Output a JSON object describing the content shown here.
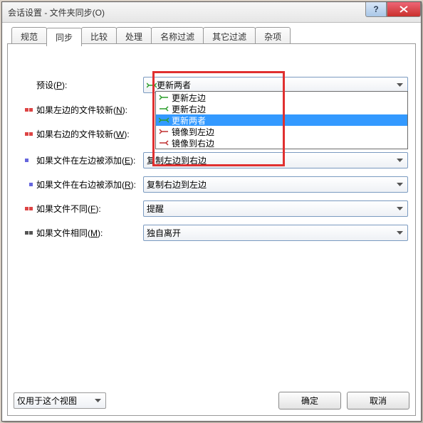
{
  "window": {
    "title": "会话设置 - 文件夹同步(O)"
  },
  "tabs": [
    "规范",
    "同步",
    "比较",
    "处理",
    "名称过滤",
    "其它过滤",
    "杂项"
  ],
  "active_tab": 1,
  "preset": {
    "label_prefix": "预设(",
    "label_key": "P",
    "label_suffix": "):",
    "value": "更新两者",
    "options": [
      "更新左边",
      "更新右边",
      "更新两者",
      "镜像到左边",
      "镜像到右边"
    ],
    "selected_index": 2
  },
  "rows": [
    {
      "bullet": [
        "#d44",
        "#d44"
      ],
      "label_prefix": "如果左边的文件较新(",
      "label_key": "N",
      "label_suffix": "):"
    },
    {
      "bullet": [
        "#d44",
        "#d44"
      ],
      "label_prefix": "如果右边的文件较新(",
      "label_key": "W",
      "label_suffix": "):"
    },
    {
      "bullet": [
        "#66d",
        ""
      ],
      "label_prefix": "如果文件在左边被添加(",
      "label_key": "E",
      "label_suffix": "):",
      "combo": "复制左边到右边"
    },
    {
      "bullet": [
        "",
        "#66d"
      ],
      "label_prefix": "如果文件在右边被添加(",
      "label_key": "R",
      "label_suffix": "):",
      "combo": "复制右边到左边"
    },
    {
      "bullet": [
        "#d44",
        "#d44"
      ],
      "label_prefix": "如果文件不同(",
      "label_key": "F",
      "label_suffix": "):",
      "combo": "提醒"
    },
    {
      "bullet": [
        "#555",
        "#555"
      ],
      "label_prefix": "如果文件相同(",
      "label_key": "M",
      "label_suffix": "):",
      "combo": "独自离开"
    }
  ],
  "footer": {
    "scope": "仅用于这个视图",
    "ok": "确定",
    "cancel": "取消"
  }
}
